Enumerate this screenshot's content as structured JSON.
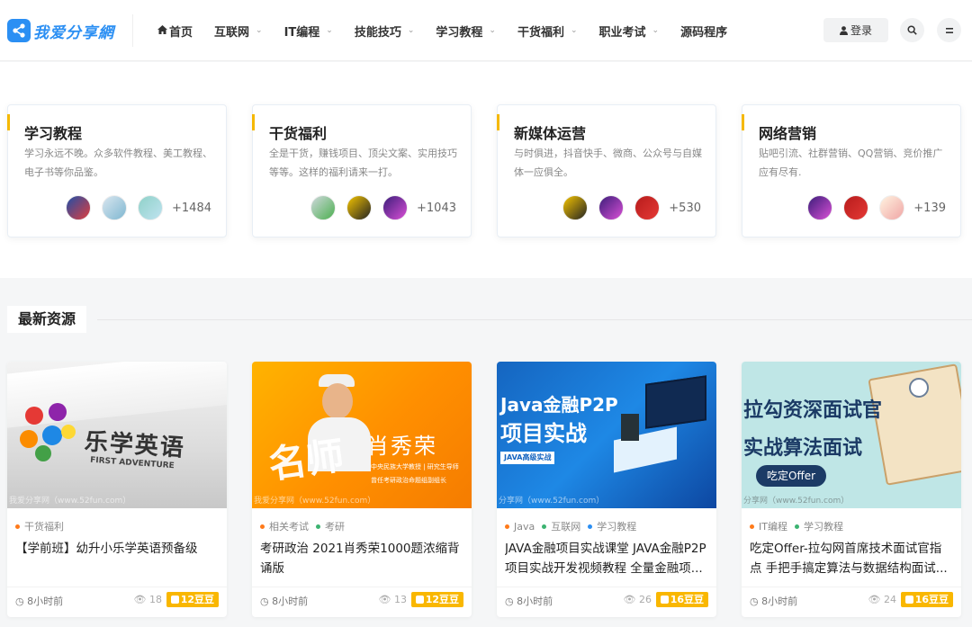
{
  "site": {
    "name": "我爱分享網"
  },
  "nav": [
    {
      "label": "首页",
      "caret": false
    },
    {
      "label": "互联网",
      "caret": true
    },
    {
      "label": "IT编程",
      "caret": true
    },
    {
      "label": "技能技巧",
      "caret": true
    },
    {
      "label": "学习教程",
      "caret": true
    },
    {
      "label": "干货福利",
      "caret": true
    },
    {
      "label": "职业考试",
      "caret": true
    },
    {
      "label": "源码程序",
      "caret": false
    }
  ],
  "actions": {
    "login_label": "登录"
  },
  "icons": {
    "home": "home-icon",
    "user": "user-icon",
    "search": "search-icon",
    "menu": "menu-icon",
    "clock": "clock-icon",
    "eye": "eye-icon",
    "coin": "coin-icon"
  },
  "colors": {
    "brand": "#2b8ff3",
    "accent": "#f5b800",
    "price": "#f9b700"
  },
  "categories": [
    {
      "title": "学习教程",
      "desc": "学习永远不晚。众多软件教程、美工教程、电子书等你品鉴。",
      "count": "+1484"
    },
    {
      "title": "干货福利",
      "desc": "全是干货，赚钱项目、顶尖文案、实用技巧等等。这样的福利请来一打。",
      "count": "+1043"
    },
    {
      "title": "新媒体运营",
      "desc": "与时俱进，抖音快手、微商、公众号与自媒体一应俱全。",
      "count": "+530"
    },
    {
      "title": "网络营销",
      "desc": "贴吧引流、社群营销、QQ营销、竞价推广应有尽有.",
      "count": "+139"
    }
  ],
  "section": {
    "title": "最新资源"
  },
  "posts": [
    {
      "thumb_text": "乐学英语",
      "thumb_sub": "FIRST ADVENTURE",
      "watermark": "我爱分享网（www.52fun.com）",
      "tags": [
        {
          "label": "干货福利",
          "color": "#ff7a1a"
        }
      ],
      "title": "【学前班】幼升小乐学英语预备级",
      "time": "8小时前",
      "views": "18",
      "price": "12豆豆"
    },
    {
      "thumb_text": "肖秀荣",
      "thumb_sub": "中央民族大学教授 | 研究生导师",
      "thumb_sub2": "曾任考研政治命题组副组长",
      "thumb_big": "名师",
      "watermark": "我爱分享网（www.52fun.com）",
      "tags": [
        {
          "label": "相关考试",
          "color": "#ff7a1a"
        },
        {
          "label": "考研",
          "color": "#3cb371"
        }
      ],
      "title": "考研政治 2021肖秀荣1000题浓缩背诵版",
      "time": "8小时前",
      "views": "13",
      "price": "12豆豆"
    },
    {
      "thumb_text": "Java金融P2P",
      "thumb_sub": "项目实战",
      "thumb_sub2": "JAVA高级实战",
      "watermark": "分享网（www.52fun.com）",
      "tags": [
        {
          "label": "Java",
          "color": "#ff7a1a"
        },
        {
          "label": "互联网",
          "color": "#3cb371"
        },
        {
          "label": "学习教程",
          "color": "#2b8ff3"
        }
      ],
      "title": "JAVA金融项目实战课堂 JAVA金融P2P项目实战开发视频教程 全量金融项...",
      "time": "8小时前",
      "views": "26",
      "price": "16豆豆"
    },
    {
      "thumb_text": "拉勾资深面试官",
      "thumb_sub": "实战算法面试",
      "thumb_sub2": "吃定Offer",
      "watermark": "分享网（www.52fun.com）",
      "tags": [
        {
          "label": "IT编程",
          "color": "#ff7a1a"
        },
        {
          "label": "学习教程",
          "color": "#3cb371"
        }
      ],
      "title": "吃定Offer-拉勾网首席技术面试官指点 手把手搞定算法与数据结构面试...",
      "time": "8小时前",
      "views": "24",
      "price": "16豆豆"
    }
  ]
}
